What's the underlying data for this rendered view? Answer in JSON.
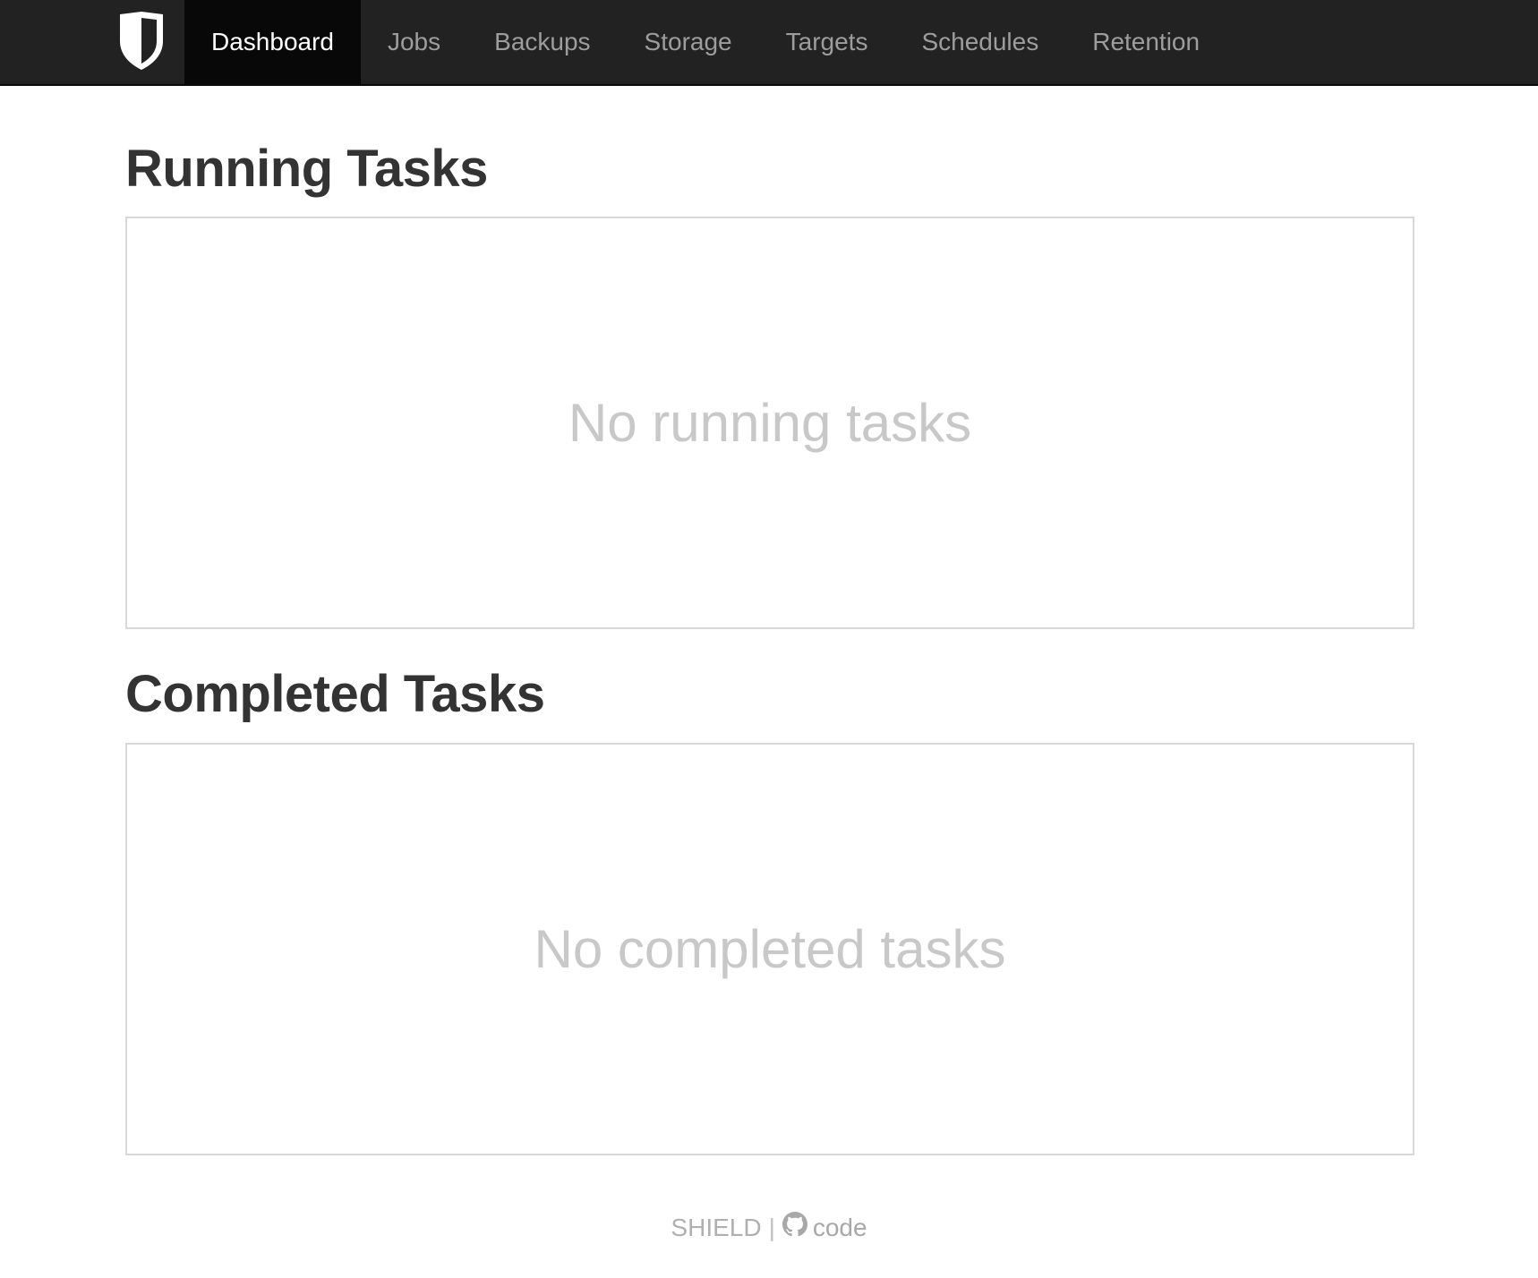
{
  "nav": {
    "logo_icon": "shield-icon",
    "items": [
      {
        "label": "Dashboard",
        "active": true
      },
      {
        "label": "Jobs",
        "active": false
      },
      {
        "label": "Backups",
        "active": false
      },
      {
        "label": "Storage",
        "active": false
      },
      {
        "label": "Targets",
        "active": false
      },
      {
        "label": "Schedules",
        "active": false
      },
      {
        "label": "Retention",
        "active": false
      }
    ]
  },
  "running": {
    "title": "Running Tasks",
    "empty_message": "No running tasks"
  },
  "completed": {
    "title": "Completed Tasks",
    "empty_message": "No completed tasks"
  },
  "footer": {
    "brand": "SHIELD",
    "separator": "|",
    "code_icon": "github-icon",
    "code_label": "code"
  },
  "colors": {
    "navbar_bg": "#222222",
    "nav_active_bg": "#080808",
    "nav_text": "#9d9d9d",
    "heading_text": "#333333",
    "empty_text": "#c8c8c8"
  }
}
